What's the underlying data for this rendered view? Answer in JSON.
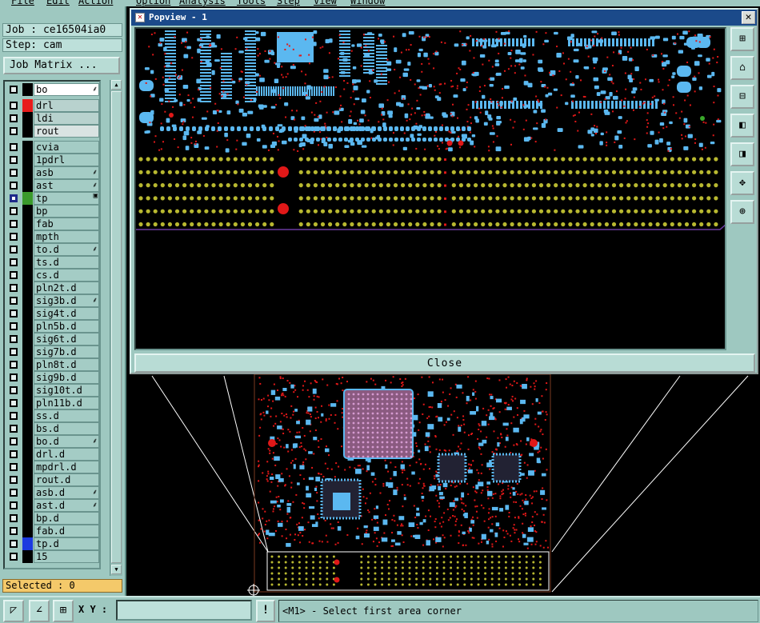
{
  "menubar": [
    "File",
    "Edit",
    "Action",
    "Option",
    "Analysis",
    "Tools",
    "Step",
    "View",
    "Window"
  ],
  "job": {
    "job_line": "Job : ce16504ia0",
    "step_line": "Step: cam",
    "matrix_button": "Job Matrix ..."
  },
  "layers": [
    {
      "name": "bo",
      "style": "white",
      "swatch": "#000000",
      "lock": true,
      "partial": true
    },
    {
      "name": "drl",
      "style": "gray",
      "swatch": "#e81c1c",
      "lock": false
    },
    {
      "name": "ldi",
      "style": "gray",
      "swatch": "#000000",
      "lock": false
    },
    {
      "name": "rout",
      "style": "light",
      "swatch": "#000000",
      "lock": false
    },
    {
      "name": "cvia",
      "style": "",
      "swatch": "#000000",
      "lock": false
    },
    {
      "name": "1pdrl",
      "style": "",
      "swatch": "#000000",
      "lock": false
    },
    {
      "name": "asb",
      "style": "",
      "swatch": "#000000",
      "lock": true
    },
    {
      "name": "ast",
      "style": "",
      "swatch": "#000000",
      "lock": true
    },
    {
      "name": "tp",
      "style": "",
      "swatch": "#3b9a2c",
      "lock": false,
      "selected": true,
      "mark": "▣"
    },
    {
      "name": "bp",
      "style": "",
      "swatch": "#000000",
      "lock": false
    },
    {
      "name": "fab",
      "style": "",
      "swatch": "#000000",
      "lock": false
    },
    {
      "name": "mpth",
      "style": "",
      "swatch": "#000000",
      "lock": false
    },
    {
      "name": "to.d",
      "style": "",
      "swatch": "#000000",
      "lock": true
    },
    {
      "name": "ts.d",
      "style": "",
      "swatch": "#000000",
      "lock": false
    },
    {
      "name": "cs.d",
      "style": "",
      "swatch": "#000000",
      "lock": false
    },
    {
      "name": "pln2t.d",
      "style": "",
      "swatch": "#000000",
      "lock": false
    },
    {
      "name": "sig3b.d",
      "style": "",
      "swatch": "#000000",
      "lock": true
    },
    {
      "name": "sig4t.d",
      "style": "",
      "swatch": "#000000",
      "lock": false
    },
    {
      "name": "pln5b.d",
      "style": "",
      "swatch": "#000000",
      "lock": false
    },
    {
      "name": "sig6t.d",
      "style": "",
      "swatch": "#000000",
      "lock": false
    },
    {
      "name": "sig7b.d",
      "style": "",
      "swatch": "#000000",
      "lock": false
    },
    {
      "name": "pln8t.d",
      "style": "",
      "swatch": "#000000",
      "lock": false
    },
    {
      "name": "sig9b.d",
      "style": "",
      "swatch": "#000000",
      "lock": false
    },
    {
      "name": "sig10t.d",
      "style": "",
      "swatch": "#000000",
      "lock": false
    },
    {
      "name": "pln11b.d",
      "style": "",
      "swatch": "#000000",
      "lock": false
    },
    {
      "name": "ss.d",
      "style": "",
      "swatch": "#000000",
      "lock": false
    },
    {
      "name": "bs.d",
      "style": "",
      "swatch": "#000000",
      "lock": false
    },
    {
      "name": "bo.d",
      "style": "",
      "swatch": "#000000",
      "lock": true
    },
    {
      "name": "drl.d",
      "style": "",
      "swatch": "#000000",
      "lock": false
    },
    {
      "name": "mpdrl.d",
      "style": "",
      "swatch": "#000000",
      "lock": false
    },
    {
      "name": "rout.d",
      "style": "",
      "swatch": "#000000",
      "lock": false
    },
    {
      "name": "asb.d",
      "style": "",
      "swatch": "#000000",
      "lock": true
    },
    {
      "name": "ast.d",
      "style": "",
      "swatch": "#000000",
      "lock": true
    },
    {
      "name": "bp.d",
      "style": "",
      "swatch": "#000000",
      "lock": false
    },
    {
      "name": "fab.d",
      "style": "",
      "swatch": "#000000",
      "lock": false
    },
    {
      "name": "tp.d",
      "style": "",
      "swatch": "#1c3ae0",
      "lock": false
    },
    {
      "name": "15",
      "style": "",
      "swatch": "#000000",
      "lock": false
    }
  ],
  "selected_label": "Selected : 0",
  "status": {
    "xy_label": "X Y :",
    "xy_value": "",
    "warn": "!",
    "message": "<M1> - Select first area corner"
  },
  "popview": {
    "title": "Popview - 1",
    "close_x": "✕",
    "close_button": "Close",
    "side_buttons": [
      "zoom-in",
      "home",
      "zoom-out",
      "back",
      "forward",
      "zoom-fit",
      "pan"
    ]
  },
  "colors": {
    "panel": "#9ec8c0",
    "pad_blue": "#5bb8f0",
    "via_red": "#e01818",
    "testpoint_yellow": "#b8b830",
    "outline_purple": "#6a3aa0"
  }
}
